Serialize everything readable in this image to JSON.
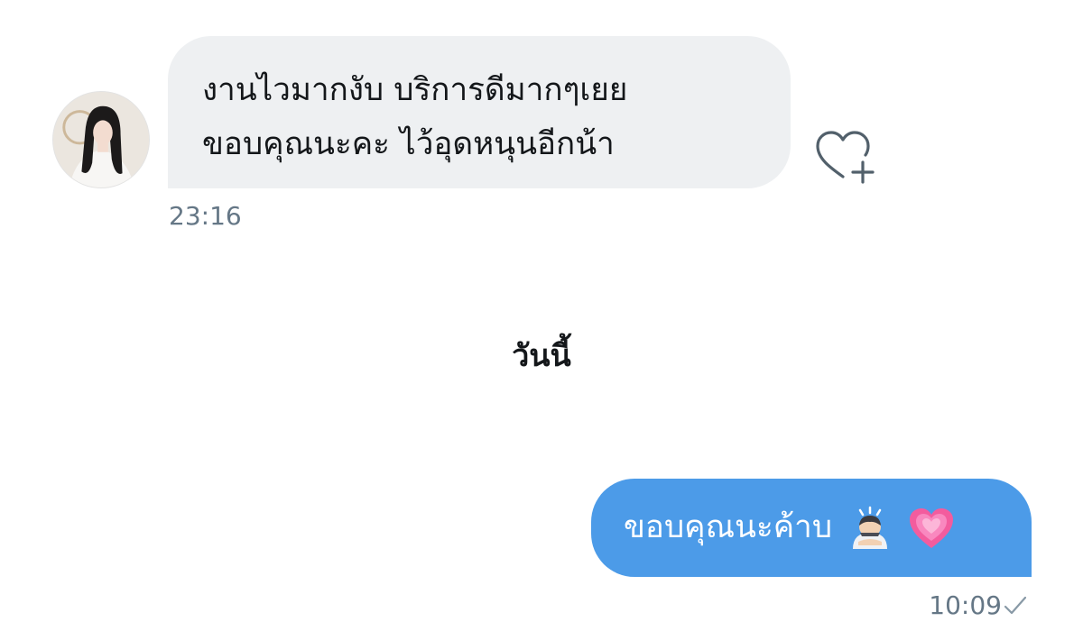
{
  "incoming_message": {
    "lines": [
      "งานไวมากงับ  บริการดีมากๆเยย",
      "ขอบคุณนะคะ ไว้อุดหนุนอีกน้า"
    ],
    "time": "23:16",
    "bubble_color": "#eef0f2"
  },
  "day_separator": "วันนี้",
  "outgoing_message": {
    "text": "ขอบคุณนะค้าบ",
    "emojis": [
      "person-bowing-emoji",
      "growing-heart-emoji"
    ],
    "time": "10:09",
    "bubble_color": "#4c9be8"
  },
  "icons": {
    "react": "heart-plus-icon",
    "sent_status": "checkmark-icon"
  }
}
